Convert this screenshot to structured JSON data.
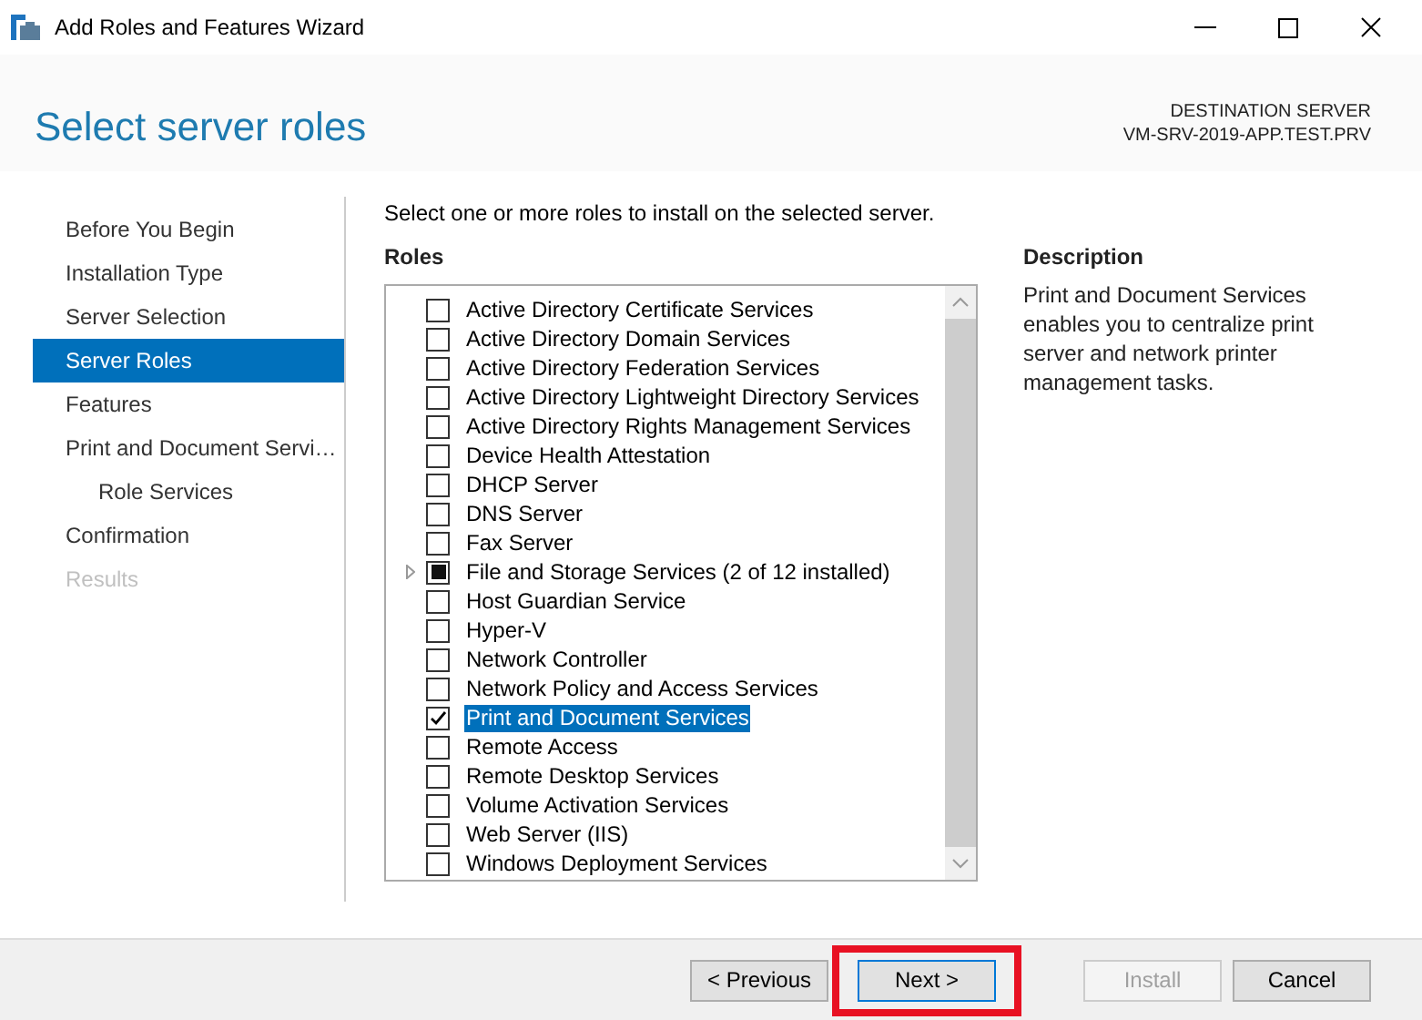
{
  "window": {
    "title": "Add Roles and Features Wizard"
  },
  "page_title": "Select server roles",
  "destination": {
    "label": "DESTINATION SERVER",
    "server": "VM-SRV-2019-APP.TEST.PRV"
  },
  "steps": [
    {
      "label": "Before You Begin",
      "selected": false,
      "disabled": false
    },
    {
      "label": "Installation Type",
      "selected": false,
      "disabled": false
    },
    {
      "label": "Server Selection",
      "selected": false,
      "disabled": false
    },
    {
      "label": "Server Roles",
      "selected": true,
      "disabled": false
    },
    {
      "label": "Features",
      "selected": false,
      "disabled": false
    },
    {
      "label": "Print and Document Servi…",
      "selected": false,
      "disabled": false,
      "children": [
        {
          "label": "Role Services",
          "selected": false,
          "disabled": false
        }
      ]
    },
    {
      "label": "Confirmation",
      "selected": false,
      "disabled": false
    },
    {
      "label": "Results",
      "selected": false,
      "disabled": true
    }
  ],
  "instruction": "Select one or more roles to install on the selected server.",
  "roles_heading": "Roles",
  "roles": [
    {
      "label": "Active Directory Certificate Services",
      "checked": false,
      "partial": false,
      "expandable": false,
      "selected": false
    },
    {
      "label": "Active Directory Domain Services",
      "checked": false,
      "partial": false,
      "expandable": false,
      "selected": false
    },
    {
      "label": "Active Directory Federation Services",
      "checked": false,
      "partial": false,
      "expandable": false,
      "selected": false
    },
    {
      "label": "Active Directory Lightweight Directory Services",
      "checked": false,
      "partial": false,
      "expandable": false,
      "selected": false
    },
    {
      "label": "Active Directory Rights Management Services",
      "checked": false,
      "partial": false,
      "expandable": false,
      "selected": false
    },
    {
      "label": "Device Health Attestation",
      "checked": false,
      "partial": false,
      "expandable": false,
      "selected": false
    },
    {
      "label": "DHCP Server",
      "checked": false,
      "partial": false,
      "expandable": false,
      "selected": false
    },
    {
      "label": "DNS Server",
      "checked": false,
      "partial": false,
      "expandable": false,
      "selected": false
    },
    {
      "label": "Fax Server",
      "checked": false,
      "partial": false,
      "expandable": false,
      "selected": false
    },
    {
      "label": "File and Storage Services (2 of 12 installed)",
      "checked": false,
      "partial": true,
      "expandable": true,
      "selected": false
    },
    {
      "label": "Host Guardian Service",
      "checked": false,
      "partial": false,
      "expandable": false,
      "selected": false
    },
    {
      "label": "Hyper-V",
      "checked": false,
      "partial": false,
      "expandable": false,
      "selected": false
    },
    {
      "label": "Network Controller",
      "checked": false,
      "partial": false,
      "expandable": false,
      "selected": false
    },
    {
      "label": "Network Policy and Access Services",
      "checked": false,
      "partial": false,
      "expandable": false,
      "selected": false
    },
    {
      "label": "Print and Document Services",
      "checked": true,
      "partial": false,
      "expandable": false,
      "selected": true
    },
    {
      "label": "Remote Access",
      "checked": false,
      "partial": false,
      "expandable": false,
      "selected": false
    },
    {
      "label": "Remote Desktop Services",
      "checked": false,
      "partial": false,
      "expandable": false,
      "selected": false
    },
    {
      "label": "Volume Activation Services",
      "checked": false,
      "partial": false,
      "expandable": false,
      "selected": false
    },
    {
      "label": "Web Server (IIS)",
      "checked": false,
      "partial": false,
      "expandable": false,
      "selected": false
    },
    {
      "label": "Windows Deployment Services",
      "checked": false,
      "partial": false,
      "expandable": false,
      "selected": false
    }
  ],
  "description": {
    "heading": "Description",
    "text": "Print and Document Services enables you to centralize print server and network printer management tasks."
  },
  "buttons": [
    {
      "label": "< Previous",
      "disabled": false,
      "focused": false,
      "highlighted": false
    },
    {
      "label": "Next >",
      "disabled": false,
      "focused": true,
      "highlighted": true
    },
    {
      "label": "Install",
      "disabled": true,
      "focused": false,
      "highlighted": false
    },
    {
      "label": "Cancel",
      "disabled": false,
      "focused": false,
      "highlighted": false
    }
  ]
}
